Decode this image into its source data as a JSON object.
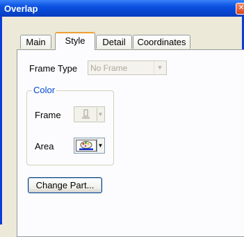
{
  "window": {
    "title": "Overlap",
    "close_glyph": "✕"
  },
  "tabs": [
    {
      "label": "Main",
      "active": false
    },
    {
      "label": "Style",
      "active": true
    },
    {
      "label": "Detail",
      "active": false
    },
    {
      "label": "Coordinates",
      "active": false
    }
  ],
  "style": {
    "frame_type_label": "Frame Type",
    "frame_type_value": "No Frame",
    "frame_type_enabled": false,
    "color_group_label": "Color",
    "frame_label": "Frame",
    "frame_icon": "paint-bucket-icon",
    "frame_enabled": false,
    "area_label": "Area",
    "area_icon": "palette-icon",
    "area_enabled": true,
    "change_part_label": "Change Part..."
  },
  "colors": {
    "titlebar": "#0a50e0",
    "group_label": "#0046d5",
    "active_tab_accent": "#f0a030",
    "disabled_text": "#aca899"
  }
}
